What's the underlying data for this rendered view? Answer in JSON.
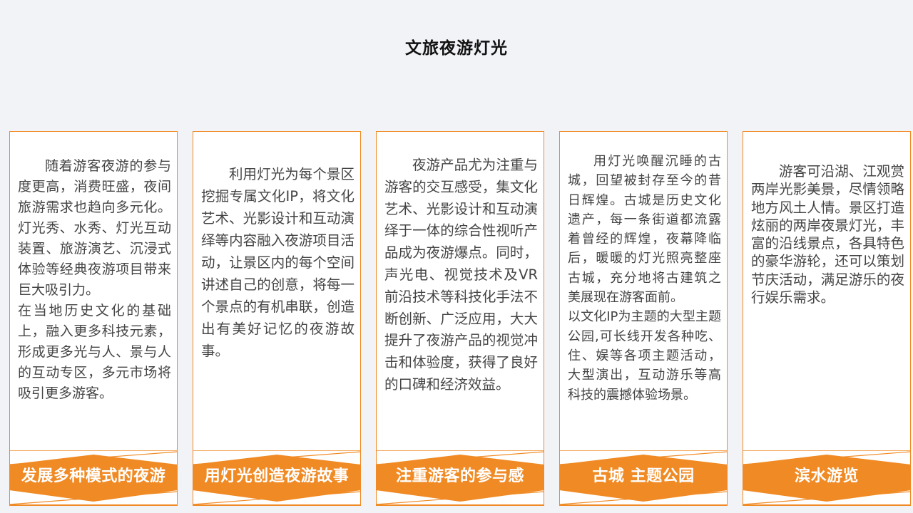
{
  "page": {
    "title": "文旅夜游灯光"
  },
  "accent": "#f08a24",
  "cards": [
    {
      "label": "发展多种模式的夜游",
      "paragraphs": [
        "随着游客夜游的参与度更高，消费旺盛，夜间旅游需求也趋向多元化。灯光秀、水秀、灯光互动装置、旅游演艺、沉浸式体验等经典夜游项目带来巨大吸引力。",
        "在当地历史文化的基础上，融入更多科技元素，形成更多光与人、景与人的互动专区，多元市场将吸引更多游客。"
      ]
    },
    {
      "label": "用灯光创造夜游故事",
      "paragraphs": [
        "利用灯光为每个景区挖掘专属文化IP，将文化艺术、光影设计和互动演绎等内容融入夜游项目活动，让景区内的每个空间讲述自己的创意，将每一个景点的有机串联，创造出有美好记忆的夜游故事。"
      ]
    },
    {
      "label": "注重游客的参与感",
      "paragraphs": [
        "夜游产品尤为注重与游客的交互感受，集文化艺术、光影设计和互动演绎于一体的综合性视听产品成为夜游爆点。同时，声光电、视觉技术及VR前沿技术等科技化手法不断创新、广泛应用，大大提升了夜游产品的视觉冲击和体验度，获得了良好的口碑和经济效益。"
      ]
    },
    {
      "label": "古城 主题公园",
      "paragraphs": [
        "用灯光唤醒沉睡的古城，回望被封存至今的昔日辉煌。古城是历史文化遗产，每一条街道都流露着曾经的辉煌，夜幕降临后，暖暖的灯光照亮整座古城，充分地将古建筑之美展现在游客面前。",
        "以文化IP为主题的大型主题公园,可长线开发各种吃、住、娱等各项主题活动，大型演出，互动游乐等高科技的震撼体验场景。"
      ]
    },
    {
      "label": "滨水游览",
      "paragraphs": [
        "游客可沿湖、江观赏两岸光影美景，尽情领略地方风土人情。景区打造炫丽的两岸夜景灯光，丰富的沿线景点，各具特色的豪华游轮，还可以策划节庆活动，满足游乐的夜行娱乐需求。"
      ]
    }
  ]
}
